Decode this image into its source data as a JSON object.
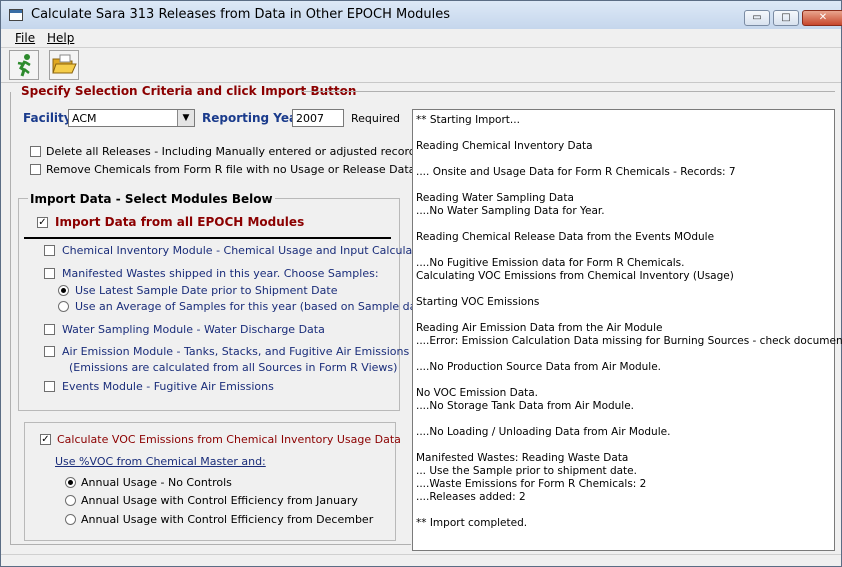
{
  "window": {
    "title": "Calculate Sara 313 Releases from Data in Other EPOCH Modules",
    "minimize_label": "▭",
    "maximize_label": "□",
    "close_label": "✕"
  },
  "menu": {
    "file": "File",
    "help": "Help"
  },
  "toolbar": {
    "run_icon": "running-man-icon",
    "open_icon": "open-folder-icon"
  },
  "criteria": {
    "title": "Specify Selection Criteria and click Import Button",
    "facility_label": "Facility",
    "facility_value": "ACM",
    "year_label": "Reporting Year",
    "year_value": "2007",
    "required_label": "Required",
    "delete_releases": {
      "label": "Delete all Releases - Including Manually entered or adjusted records",
      "checked": false
    },
    "remove_chemicals": {
      "label": "Remove Chemicals from Form R file with no Usage or Release Data",
      "checked": false
    }
  },
  "import": {
    "title": "Import Data - Select Modules Below",
    "all_modules": {
      "label": "Import Data from all EPOCH Modules",
      "checked": true
    },
    "chemical_inventory": {
      "label": "Chemical Inventory Module - Chemical Usage and Input Calculations",
      "checked": false
    },
    "manifested_wastes": {
      "label": "Manifested Wastes shipped in this year.  Choose Samples:",
      "checked": false
    },
    "sample_latest": {
      "label": "Use Latest Sample Date prior to Shipment Date",
      "selected": true
    },
    "sample_average": {
      "label": "Use an Average of Samples for this year (based on Sample date)",
      "selected": false
    },
    "water_sampling": {
      "label": "Water Sampling Module - Water Discharge Data",
      "checked": false
    },
    "air_emission": {
      "label": "Air Emission Module - Tanks, Stacks, and Fugitive Air Emissions",
      "checked": false
    },
    "air_emission_note": "(Emissions are calculated from all Sources in Form R Views)",
    "events": {
      "label": "Events Module - Fugitive Air Emissions",
      "checked": false
    }
  },
  "voc": {
    "calculate": {
      "label": "Calculate VOC Emissions from Chemical Inventory Usage Data",
      "checked": true
    },
    "use_label": "Use %VOC from Chemical Master and:",
    "options": [
      {
        "label": "Annual Usage - No Controls",
        "selected": true
      },
      {
        "label": "Annual Usage with Control Efficiency  from January",
        "selected": false
      },
      {
        "label": "Annual Usage with Control Efficiency from December",
        "selected": false
      }
    ]
  },
  "log": [
    "** Starting Import...",
    "Reading Chemical Inventory Data",
    ".... Onsite and Usage Data for Form R Chemicals - Records:  7",
    "Reading Water Sampling Data",
    "....No Water Sampling Data for Year.",
    "Reading Chemical Release Data from the Events MOdule",
    "....No Fugitive Emission data for Form R Chemicals.",
    "Calculating VOC Emissions from Chemical Inventory (Usage)",
    "Starting VOC Emissions",
    "Reading Air Emission Data from the Air Module",
    "....Error: Emission Calculation Data missing for Burning Sources - check documentation.",
    "....No Production Source Data from Air Module.",
    "No VOC Emission Data.",
    "....No Storage Tank Data from Air Module.",
    "....No Loading / Unloading Data from Air Module.",
    "Manifested Wastes:  Reading Waste Data",
    "... Use the Sample prior to shipment date.",
    "....Waste Emissions for Form R Chemicals:  2",
    "....Releases added:  2",
    "** Import completed."
  ]
}
